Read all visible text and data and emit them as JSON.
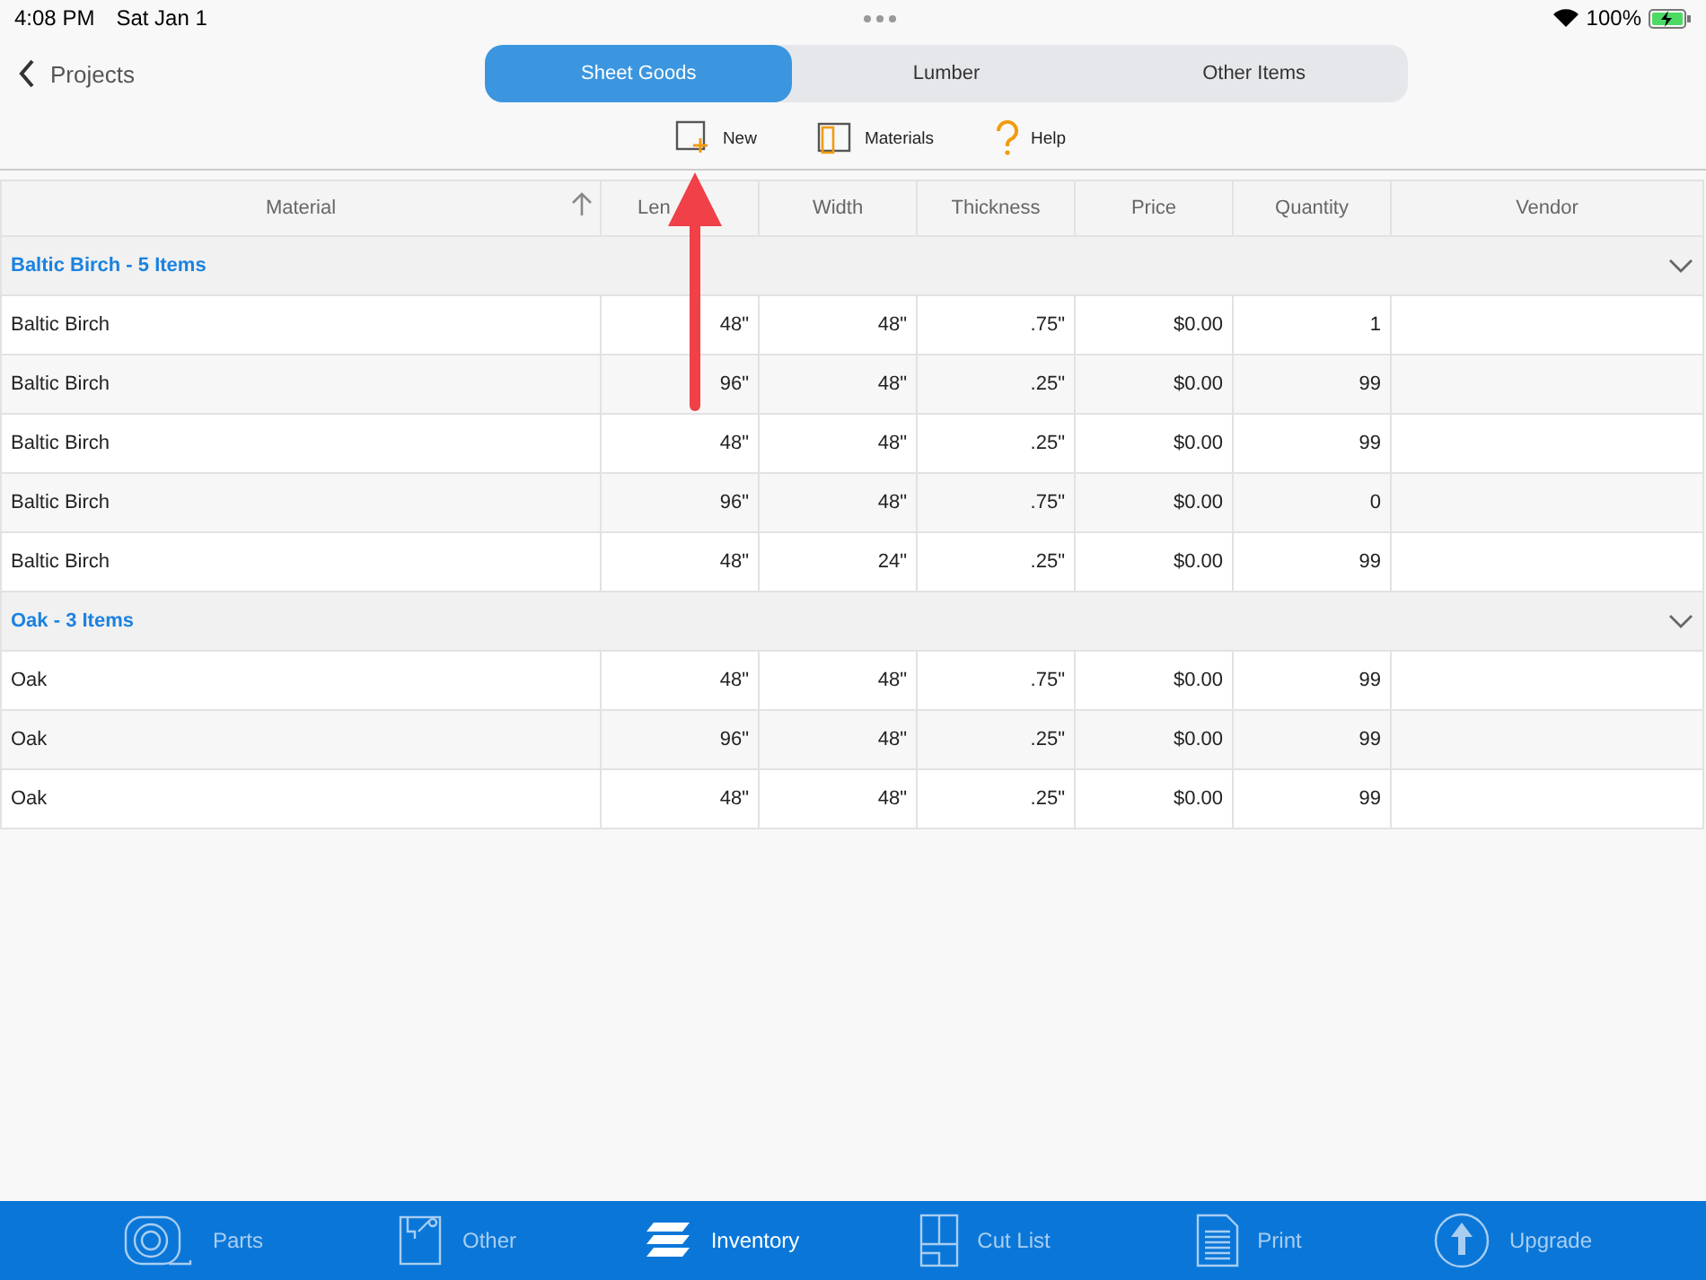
{
  "status_bar": {
    "time": "4:08 PM",
    "date": "Sat Jan 1",
    "battery": "100%"
  },
  "nav": {
    "back": "Projects"
  },
  "segments": [
    {
      "label": "Sheet Goods",
      "selected": true
    },
    {
      "label": "Lumber",
      "selected": false
    },
    {
      "label": "Other Items",
      "selected": false
    }
  ],
  "toolbar": [
    {
      "kind": "new",
      "label": "New"
    },
    {
      "kind": "materials",
      "label": "Materials"
    },
    {
      "kind": "help",
      "label": "Help"
    }
  ],
  "table": {
    "columns": [
      "Material",
      "Len",
      "Width",
      "Thickness",
      "Price",
      "Quantity",
      "Vendor"
    ],
    "groups": [
      {
        "title": "Baltic Birch - 5 Items",
        "expanded": true,
        "rows": [
          [
            "Baltic Birch",
            "48\"",
            "48\"",
            ".75\"",
            "$0.00",
            "1"
          ],
          [
            "Baltic Birch",
            "96\"",
            "48\"",
            ".25\"",
            "$0.00",
            "99"
          ],
          [
            "Baltic Birch",
            "48\"",
            "48\"",
            ".25\"",
            "$0.00",
            "99"
          ],
          [
            "Baltic Birch",
            "96\"",
            "48\"",
            ".75\"",
            "$0.00",
            "0"
          ],
          [
            "Baltic Birch",
            "48\"",
            "24\"",
            ".25\"",
            "$0.00",
            "99"
          ]
        ]
      },
      {
        "title": "Oak - 3 Items",
        "expanded": true,
        "rows": [
          [
            "Oak",
            "48\"",
            "48\"",
            ".75\"",
            "$0.00",
            "99"
          ],
          [
            "Oak",
            "96\"",
            "48\"",
            ".25\"",
            "$0.00",
            "99"
          ],
          [
            "Oak",
            "48\"",
            "48\"",
            ".25\"",
            "$0.00",
            "99"
          ]
        ]
      }
    ]
  },
  "tab_bar": [
    {
      "kind": "parts",
      "label": "Parts",
      "selected": false
    },
    {
      "kind": "other",
      "label": "Other",
      "selected": false
    },
    {
      "kind": "inventory",
      "label": "Inventory",
      "selected": true
    },
    {
      "kind": "cutlist",
      "label": "Cut List",
      "selected": false
    },
    {
      "kind": "print",
      "label": "Print",
      "selected": false
    },
    {
      "kind": "upgrade",
      "label": "Upgrade",
      "selected": false
    }
  ]
}
